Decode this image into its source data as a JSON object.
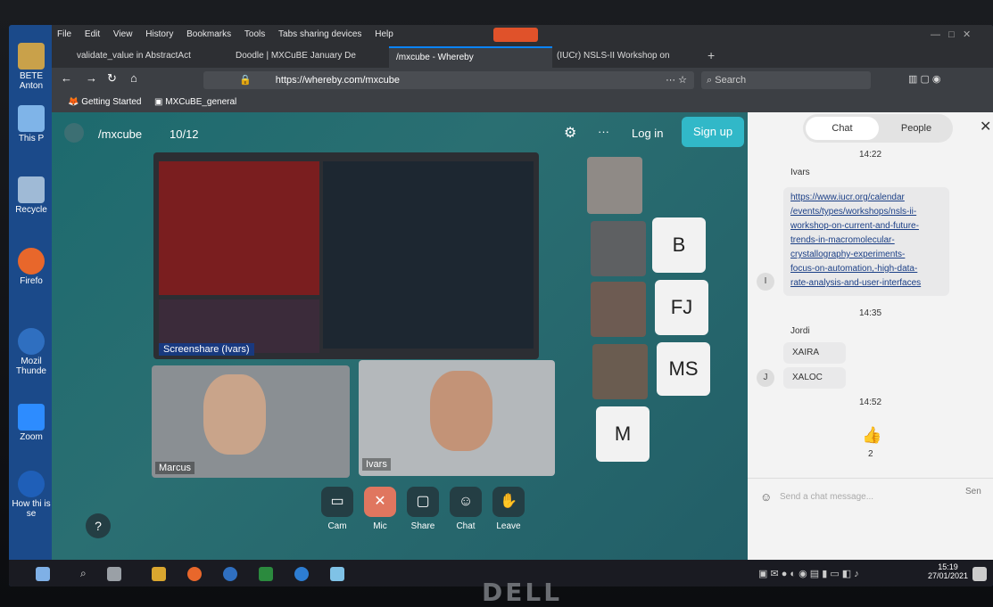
{
  "menu": [
    "File",
    "Edit",
    "View",
    "History",
    "Bookmarks",
    "Tools",
    "Tabs sharing devices",
    "Help"
  ],
  "tabs": [
    {
      "label": "validate_value in AbstractAct",
      "active": false
    },
    {
      "label": "Doodle | MXCuBE January De",
      "active": false
    },
    {
      "label": "/mxcube - Whereby",
      "active": true
    },
    {
      "label": "(IUCr) NSLS-II Workshop on",
      "active": false
    }
  ],
  "nav": {
    "url": "https://whereby.com/mxcube",
    "search_placeholder": "Search"
  },
  "bookmarks": [
    "Getting Started",
    "MXCuBE_general"
  ],
  "desktop_icons": [
    "BETE Anton",
    "This P",
    "Recycle",
    "Firefo",
    "Mozil Thunde",
    "Zoom",
    "How thi is se"
  ],
  "room": {
    "name": "/mxcube",
    "count": "10/12",
    "login": "Log in",
    "signup": "Sign up"
  },
  "screenshare_label": "Screenshare (Ivars)",
  "videos": {
    "marcus": "Marcus",
    "ivars": "Ivars"
  },
  "letters": [
    "B",
    "FJ",
    "MS",
    "M"
  ],
  "controls": [
    {
      "label": "Cam",
      "icon": "cam-icon"
    },
    {
      "label": "Mic",
      "icon": "mic-off-icon"
    },
    {
      "label": "Share",
      "icon": "share-icon"
    },
    {
      "label": "Chat",
      "icon": "chat-icon"
    },
    {
      "label": "Leave",
      "icon": "leave-icon"
    }
  ],
  "help": "?",
  "chat": {
    "tab_chat": "Chat",
    "tab_people": "People",
    "time1": "14:22",
    "sender1": "Ivars",
    "avatar1": "I",
    "link_lines": [
      "https://www.iucr.org/calendar",
      "/events/types/workshops/nsls-ii-",
      "workshop-on-current-and-future-",
      "trends-in-macromolecular-",
      "crystallography-experiments-",
      "focus-on-automation,-high-data-",
      "rate-analysis-and-user-interfaces"
    ],
    "time2": "14:35",
    "sender2": "Jordi",
    "avatar2": "J",
    "msg2a": "XAIRA",
    "msg2b": "XALOC",
    "time3": "14:52",
    "reaction_count": "2",
    "input_placeholder": "Send a chat message...",
    "send": "Sen"
  },
  "clock": {
    "time": "15:19",
    "date": "27/01/2021"
  },
  "brand": "DELL"
}
